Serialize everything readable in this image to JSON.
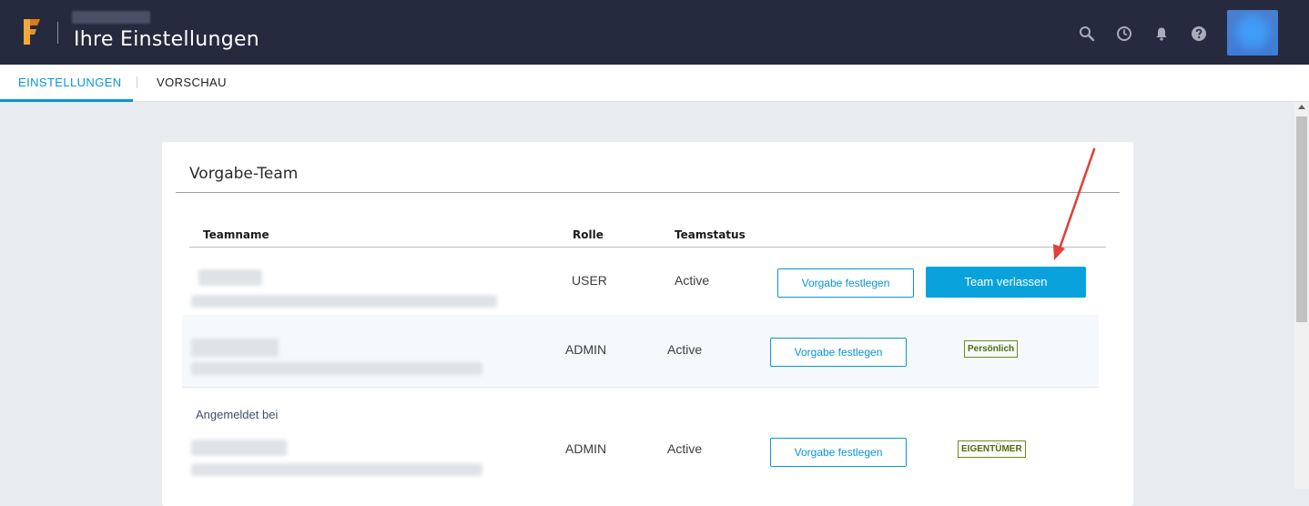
{
  "header": {
    "title": "Ihre Einstellungen",
    "icons": [
      "search-icon",
      "history-icon",
      "bell-icon",
      "help-icon"
    ]
  },
  "tabs": [
    {
      "label": "EINSTELLUNGEN",
      "active": true
    },
    {
      "label": "VORSCHAU",
      "active": false
    }
  ],
  "section": {
    "title": "Vorgabe-Team"
  },
  "table": {
    "headers": {
      "teamname": "Teamname",
      "rolle": "Rolle",
      "teamstatus": "Teamstatus"
    },
    "rows": [
      {
        "role": "USER",
        "status": "Active",
        "set_default_label": "Vorgabe festlegen",
        "leave_label": "Team verlassen"
      },
      {
        "role": "ADMIN",
        "status": "Active",
        "set_default_label": "Vorgabe festlegen",
        "badge": "Persönlich"
      },
      {
        "signed_in_label": "Angemeldet bei",
        "role": "ADMIN",
        "status": "Active",
        "set_default_label": "Vorgabe festlegen",
        "badge": "EIGENTÜMER"
      }
    ]
  },
  "colors": {
    "header_bg": "#252a3f",
    "accent": "#0696d7",
    "primary_button": "#0aa2dd",
    "badge_green": "#4d6b0a",
    "annotation_arrow": "#e0413a"
  }
}
